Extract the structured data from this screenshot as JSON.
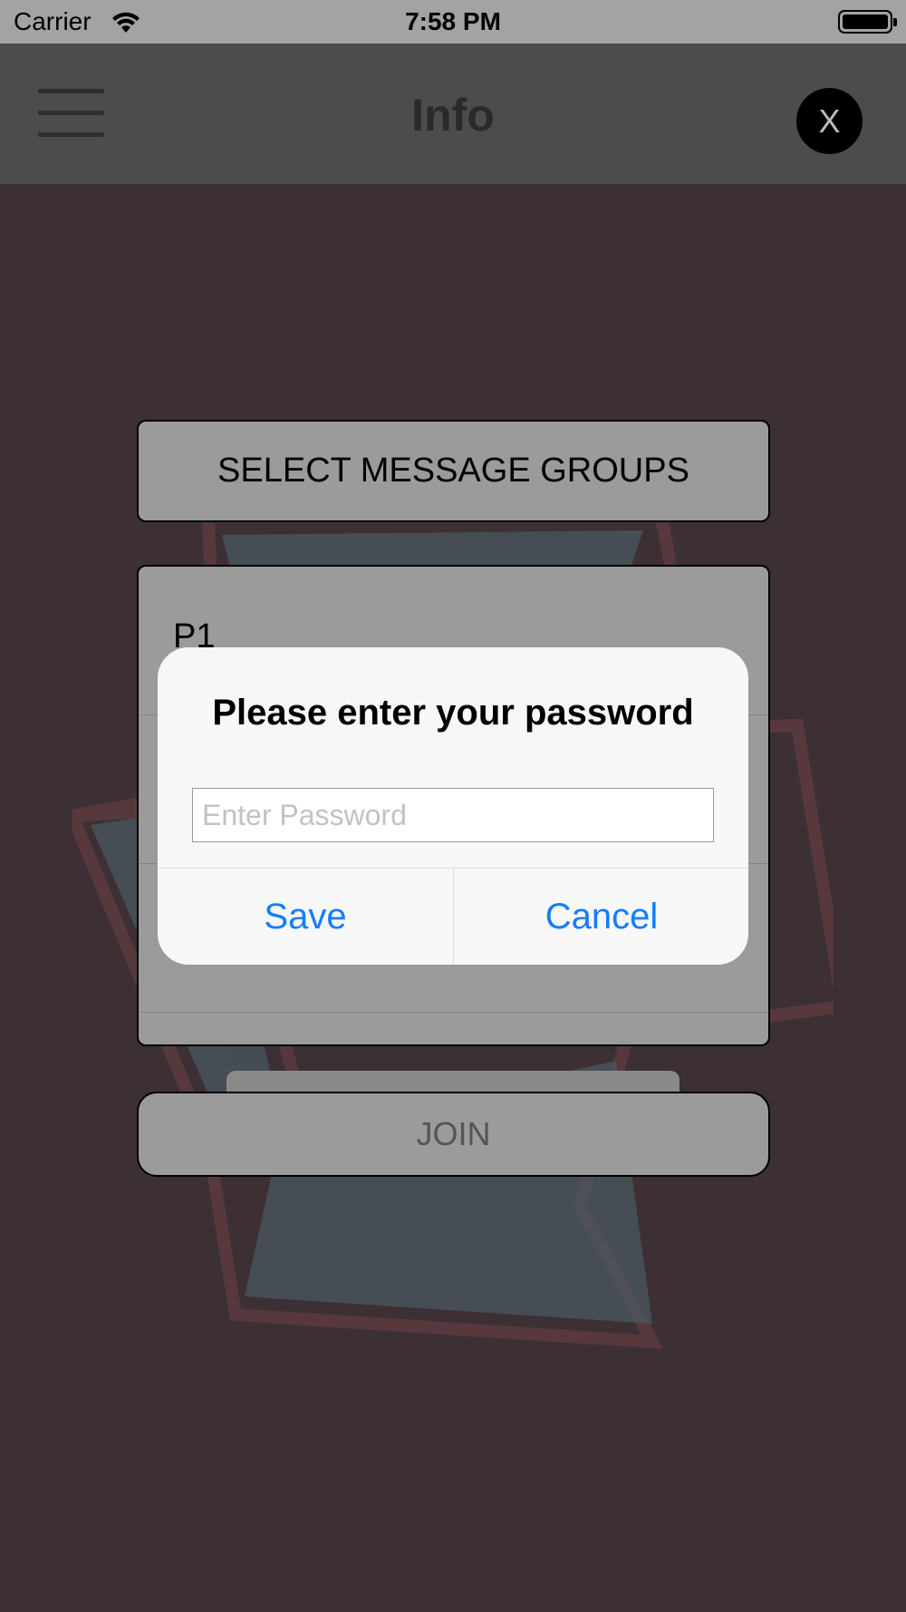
{
  "status_bar": {
    "carrier": "Carrier",
    "time": "7:58 PM"
  },
  "nav_bar": {
    "title": "Info",
    "close_label": "X",
    "menu_icon": "hamburger-menu-icon"
  },
  "main": {
    "select_groups_label": "SELECT MESSAGE GROUPS",
    "groups": [
      "P1"
    ],
    "join_label": "JOIN"
  },
  "alert": {
    "title": "Please enter your password",
    "input_placeholder": "Enter Password",
    "input_value": "",
    "save_label": "Save",
    "cancel_label": "Cancel"
  },
  "colors": {
    "background": "#3c3034",
    "nav_bar": "#4c4c4c",
    "status_bar": "#a3a3a3",
    "alert_background": "#f7f7f7",
    "alert_button_text": "#147efb"
  }
}
